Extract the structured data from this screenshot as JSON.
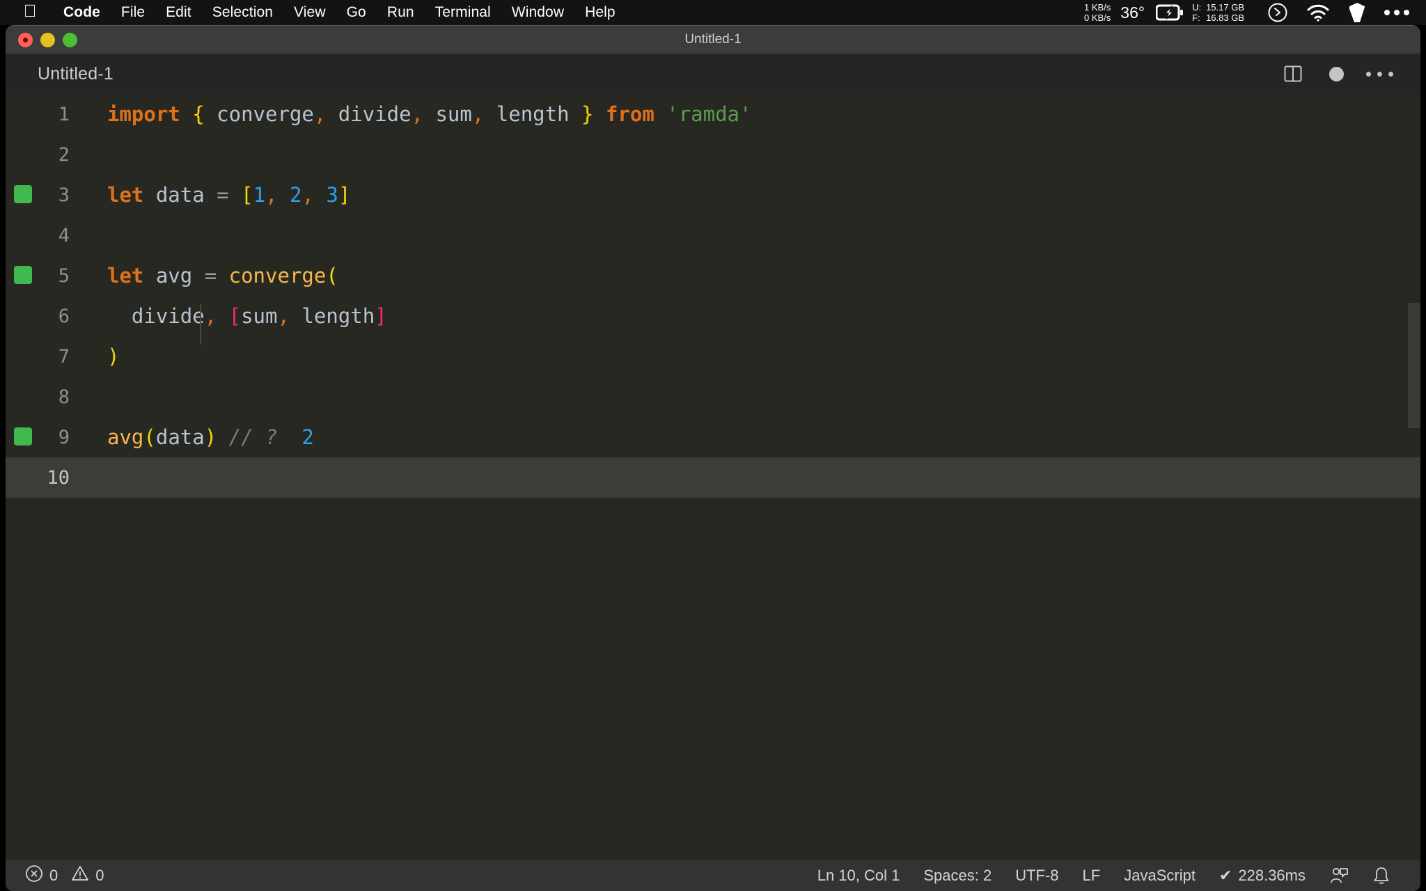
{
  "menubar": {
    "apple_icon": "apple-logo-icon",
    "items": [
      {
        "label": "Code",
        "bold": true
      },
      {
        "label": "File",
        "bold": false
      },
      {
        "label": "Edit",
        "bold": false
      },
      {
        "label": "Selection",
        "bold": false
      },
      {
        "label": "View",
        "bold": false
      },
      {
        "label": "Go",
        "bold": false
      },
      {
        "label": "Run",
        "bold": false
      },
      {
        "label": "Terminal",
        "bold": false
      },
      {
        "label": "Window",
        "bold": false
      },
      {
        "label": "Help",
        "bold": false
      }
    ],
    "status": {
      "net_up": "1 KB/s",
      "net_down": "0 KB/s",
      "temperature": "36°",
      "battery_icon": "battery-charging-icon",
      "mem_used_label": "U:",
      "mem_used_value": "15.17 GB",
      "mem_free_label": "F:",
      "mem_free_value": "16.83 GB",
      "clock_icon": "clock-icon",
      "wifi_icon": "wifi-icon",
      "shield_icon": "shield-icon",
      "more_icon": "ellipsis-icon"
    }
  },
  "window": {
    "title": "Untitled-1",
    "traffic": {
      "close": "close-button",
      "minimize": "minimize-button",
      "zoom": "zoom-button"
    }
  },
  "tabbar": {
    "tab_label": "Untitled-1",
    "split_icon": "split-editor-icon",
    "dirty_icon": "unsaved-dot-icon",
    "more_icon": "more-actions-icon"
  },
  "editor": {
    "lines": [
      {
        "num": "1",
        "marked": false,
        "indent_guide": false,
        "current": false,
        "tokens": [
          {
            "t": "import",
            "c": "t-kw"
          },
          {
            "t": " ",
            "c": "t-var"
          },
          {
            "t": "{",
            "c": "t-brace"
          },
          {
            "t": " converge",
            "c": "t-var"
          },
          {
            "t": ",",
            "c": "t-punc"
          },
          {
            "t": " divide",
            "c": "t-var"
          },
          {
            "t": ",",
            "c": "t-punc"
          },
          {
            "t": " sum",
            "c": "t-var"
          },
          {
            "t": ",",
            "c": "t-punc"
          },
          {
            "t": " length ",
            "c": "t-var"
          },
          {
            "t": "}",
            "c": "t-brace"
          },
          {
            "t": " ",
            "c": "t-var"
          },
          {
            "t": "from",
            "c": "t-kw"
          },
          {
            "t": " ",
            "c": "t-var"
          },
          {
            "t": "'ramda'",
            "c": "t-str"
          }
        ]
      },
      {
        "num": "2",
        "marked": false,
        "indent_guide": false,
        "current": false,
        "tokens": []
      },
      {
        "num": "3",
        "marked": true,
        "indent_guide": false,
        "current": false,
        "tokens": [
          {
            "t": "let",
            "c": "t-kw"
          },
          {
            "t": " data ",
            "c": "t-var"
          },
          {
            "t": "=",
            "c": "t-op"
          },
          {
            "t": " ",
            "c": "t-var"
          },
          {
            "t": "[",
            "c": "t-brace"
          },
          {
            "t": "1",
            "c": "t-num"
          },
          {
            "t": ",",
            "c": "t-punc"
          },
          {
            "t": " ",
            "c": "t-var"
          },
          {
            "t": "2",
            "c": "t-num"
          },
          {
            "t": ",",
            "c": "t-punc"
          },
          {
            "t": " ",
            "c": "t-var"
          },
          {
            "t": "3",
            "c": "t-num"
          },
          {
            "t": "]",
            "c": "t-brace"
          }
        ]
      },
      {
        "num": "4",
        "marked": false,
        "indent_guide": false,
        "current": false,
        "tokens": []
      },
      {
        "num": "5",
        "marked": true,
        "indent_guide": false,
        "current": false,
        "tokens": [
          {
            "t": "let",
            "c": "t-kw"
          },
          {
            "t": " avg ",
            "c": "t-var"
          },
          {
            "t": "=",
            "c": "t-op"
          },
          {
            "t": " ",
            "c": "t-var"
          },
          {
            "t": "converge",
            "c": "t-fn"
          },
          {
            "t": "(",
            "c": "t-brace"
          }
        ]
      },
      {
        "num": "6",
        "marked": false,
        "indent_guide": true,
        "current": false,
        "tokens": [
          {
            "t": "  divide",
            "c": "t-var"
          },
          {
            "t": ",",
            "c": "t-punc"
          },
          {
            "t": " ",
            "c": "t-var"
          },
          {
            "t": "[",
            "c": "t-bracketM"
          },
          {
            "t": "sum",
            "c": "t-var"
          },
          {
            "t": ",",
            "c": "t-punc"
          },
          {
            "t": " length",
            "c": "t-var"
          },
          {
            "t": "]",
            "c": "t-bracketM"
          }
        ]
      },
      {
        "num": "7",
        "marked": false,
        "indent_guide": false,
        "current": false,
        "tokens": [
          {
            "t": ")",
            "c": "t-brace"
          }
        ]
      },
      {
        "num": "8",
        "marked": false,
        "indent_guide": false,
        "current": false,
        "tokens": []
      },
      {
        "num": "9",
        "marked": true,
        "indent_guide": false,
        "current": false,
        "tokens": [
          {
            "t": "avg",
            "c": "t-fn"
          },
          {
            "t": "(",
            "c": "t-brace"
          },
          {
            "t": "data",
            "c": "t-var"
          },
          {
            "t": ")",
            "c": "t-brace"
          },
          {
            "t": " ",
            "c": "t-var"
          },
          {
            "t": "// ?",
            "c": "t-comment"
          },
          {
            "t": "  ",
            "c": "t-var"
          },
          {
            "t": "2",
            "c": "t-num"
          }
        ]
      },
      {
        "num": "10",
        "marked": false,
        "indent_guide": false,
        "current": true,
        "tokens": []
      }
    ]
  },
  "statusbar": {
    "errors_icon": "error-circle-icon",
    "errors_count": "0",
    "warnings_icon": "warning-triangle-icon",
    "warnings_count": "0",
    "cursor_position": "Ln 10, Col 1",
    "indentation": "Spaces: 2",
    "encoding": "UTF-8",
    "eol": "LF",
    "language": "JavaScript",
    "quokka_check": "✔",
    "quokka_time": "228.36ms",
    "feedback_icon": "feedback-icon",
    "bell_icon": "bell-icon"
  }
}
